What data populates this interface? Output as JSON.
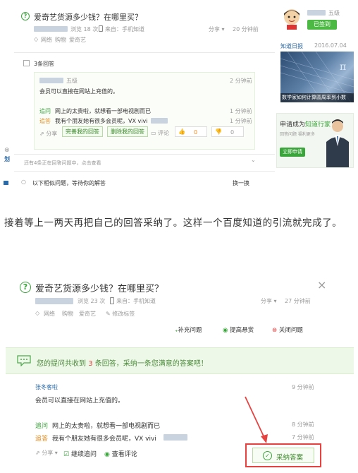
{
  "top": {
    "title": "爱奇艺货源多少钱？在哪里买？",
    "views": "浏览 18 次",
    "source": "来自：手机知道",
    "share": "分享",
    "answered": "20 分钟前",
    "tags": [
      "网络",
      "购物",
      "爱奇艺"
    ],
    "answers_heading": "3条回答",
    "answer": {
      "user_level": "五级",
      "time": "2 分钟前",
      "text": "会员可以直接在网站上充值的。",
      "followup_label": "追问",
      "followup_text": "网上的太贵啦，就想看一部电视剧而已",
      "followup_time": "1 分钟前",
      "reply_label": "追答",
      "reply_text": "我有个朋友她有很多会员呢，VX vivi",
      "reply_time": "1 分钟前",
      "share": "分享",
      "perfect_btn": "完善我的回答",
      "delete_btn": "删除我的回答",
      "comment": "评论",
      "like_count": "0",
      "dislike_count": "0"
    },
    "notice": "还有4条正在回答问题中，点击查看",
    "similar_text": "以下相似问题，等待你的解答",
    "similar_action": "换一换",
    "left_glyph": "划",
    "sidebar": {
      "level": "五级",
      "signed_btn": "已签到",
      "daily_title": "知道日报",
      "daily_date": "2016.07.04",
      "daily_caption": "数学家如何计算圆周率到小数",
      "promo_title": "申请成为",
      "promo_highlight": "知道行家",
      "promo_links": "回答问题  福利更多",
      "promo_btn": "立即申请"
    }
  },
  "article": {
    "paragraph": "接着等上一两天再把自己的回答采纳了。这样一个百度知道的引流就完成了。"
  },
  "bottom": {
    "title": "爱奇艺货源多少钱？在哪里买？",
    "views": "浏览 23 次",
    "source": "来自：手机知道",
    "share": "分享",
    "answered": "27 分钟前",
    "tags": [
      "网络",
      "购物",
      "爱奇艺"
    ],
    "edit_tags": "修改标签",
    "actions": [
      "补充问题",
      "提高悬赏",
      "关闭问题"
    ],
    "banner_prefix": "您的提问共收到",
    "banner_count": "3",
    "banner_suffix": "条回答，采纳一条您满意的答案吧！",
    "answerer": "张冬客啦",
    "answer_time": "9 分钟前",
    "answer_text": "会员可以直接在网站上充值的。",
    "followup_label": "追问",
    "followup_text": "网上的太贵啦，就想看一部电视剧而已",
    "followup_time": "8 分钟前",
    "reply_label": "追答",
    "reply_text": "我有个朋友她有很多会员呢，VX vivi",
    "reply_time": "7 分钟前",
    "continue_ask": "继续追问",
    "view_comments": "查看评论",
    "adopt_btn": "采纳答案"
  },
  "colors": {
    "green": "#3aa53a",
    "red": "#e64340",
    "banner_bg": "#eef8e8"
  }
}
